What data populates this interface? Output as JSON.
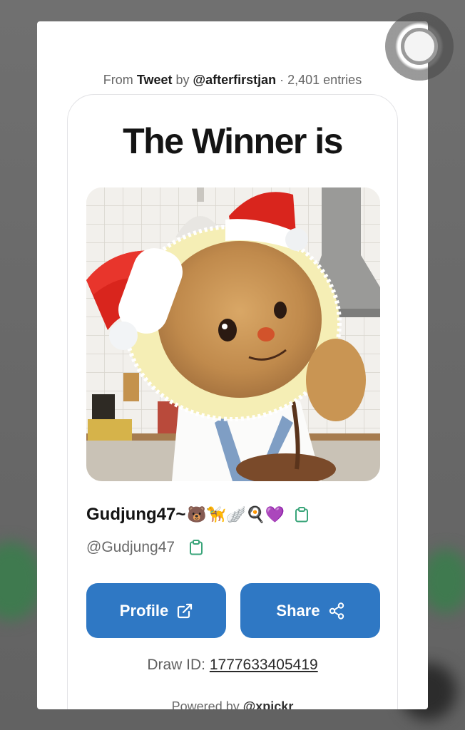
{
  "source": {
    "prefix": "From",
    "platform": "Tweet",
    "by": "by",
    "account": "@afterfirstjan",
    "separator": " · ",
    "entries": "2,401 entries"
  },
  "card": {
    "title": "The Winner is",
    "winner_name": "Gudjung47~",
    "winner_emojis": "🐻🦮🪽🍳💜",
    "winner_handle": "@Gudjung47"
  },
  "buttons": {
    "profile_label": "Profile",
    "share_label": "Share"
  },
  "draw": {
    "label": "Draw ID:",
    "id": "1777633405419"
  },
  "footer": {
    "powered_prefix": "Powered by",
    "powered_brand": "@xpickr"
  },
  "colors": {
    "primary": "#2f78c4",
    "copy_icon": "#3aa57a"
  },
  "icons": [
    "copy-icon",
    "external-link-icon",
    "share-icon"
  ]
}
